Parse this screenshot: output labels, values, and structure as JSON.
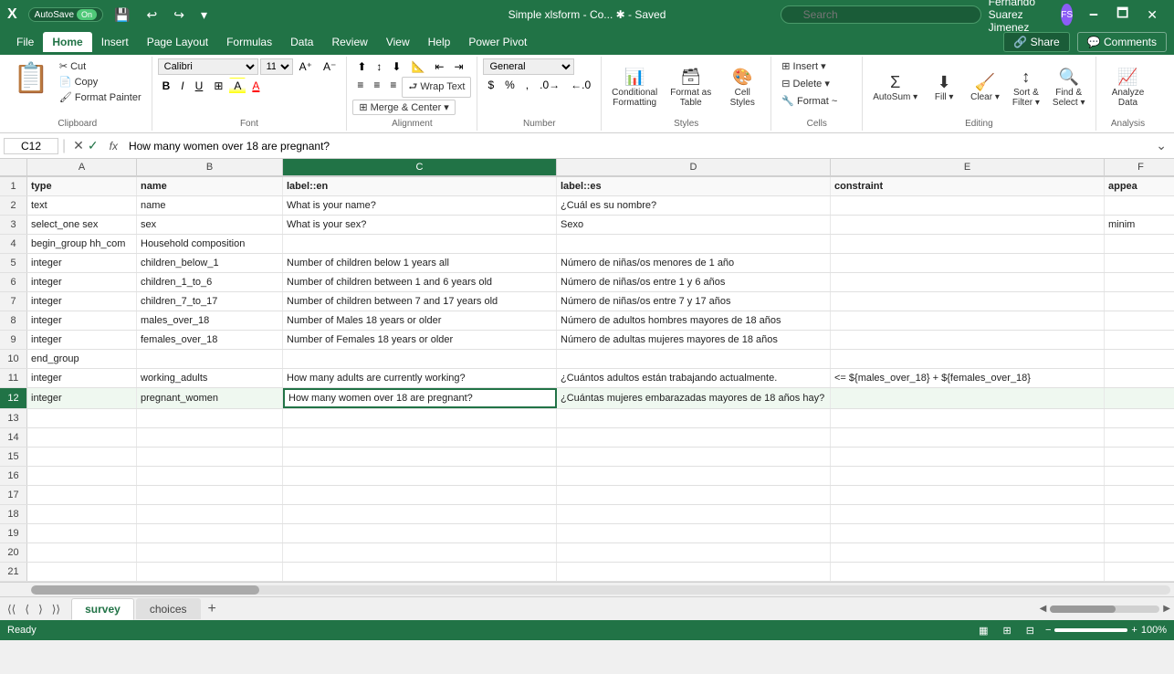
{
  "titlebar": {
    "autosave_label": "AutoSave",
    "autosave_state": "On",
    "title": "Simple xlsform - Co... ✱ - Saved",
    "search_placeholder": "Search",
    "user_name": "Fernando Suarez Jimenez",
    "undo": "↩",
    "redo": "↪",
    "minimize": "🗕",
    "maximize": "🗖",
    "close": "✕"
  },
  "tabs": {
    "items": [
      "File",
      "Home",
      "Insert",
      "Page Layout",
      "Formulas",
      "Data",
      "Review",
      "View",
      "Help",
      "Power Pivot"
    ],
    "active": "Home"
  },
  "ribbon": {
    "clipboard": {
      "label": "Clipboard",
      "paste_label": "Paste",
      "cut_label": "Cut",
      "copy_label": "Copy",
      "format_painter_label": "Format Painter"
    },
    "font": {
      "label": "Font",
      "font_name": "Calibri",
      "font_size": "11",
      "bold": "B",
      "italic": "I",
      "underline": "U"
    },
    "alignment": {
      "label": "Alignment",
      "wrap_text": "Wrap Text",
      "merge_center": "Merge & Center"
    },
    "number": {
      "label": "Number",
      "format": "General"
    },
    "styles": {
      "label": "Styles",
      "conditional_formatting": "Conditional Formatting",
      "format_as_table": "Format as Table",
      "cell_styles": "Cell Styles"
    },
    "cells": {
      "label": "Cells",
      "insert": "Insert",
      "delete": "Delete",
      "format": "Format ~"
    },
    "editing": {
      "label": "Editing",
      "sort_filter": "Sort & Filter",
      "find_select": "Find & Select ~",
      "analyze": "Analyze Data"
    }
  },
  "formula_bar": {
    "cell_ref": "C12",
    "formula": "How many women over 18 are pregnant?"
  },
  "columns": {
    "headers": [
      "A",
      "B",
      "C",
      "D",
      "E",
      "F"
    ],
    "labels": [
      "",
      "",
      "",
      "",
      "",
      ""
    ]
  },
  "spreadsheet": {
    "rows": [
      {
        "num": "1",
        "cells": [
          "type",
          "name",
          "label::en",
          "label::es",
          "constraint",
          "appea"
        ]
      },
      {
        "num": "2",
        "cells": [
          "text",
          "name",
          "What is your name?",
          "¿Cuál es su nombre?",
          "",
          ""
        ]
      },
      {
        "num": "3",
        "cells": [
          "select_one sex",
          "sex",
          "What is your sex?",
          "Sexo",
          "",
          "minim"
        ]
      },
      {
        "num": "4",
        "cells": [
          "begin_group hh_com",
          "Household composition",
          "",
          "",
          "",
          ""
        ]
      },
      {
        "num": "5",
        "cells": [
          "integer",
          "children_below_1",
          "Number of children below 1 years all",
          "Número de niñas/os menores de 1 año",
          "",
          ""
        ]
      },
      {
        "num": "6",
        "cells": [
          "integer",
          "children_1_to_6",
          "Number of children between 1 and 6 years old",
          "Número de niñas/os entre 1 y 6 años",
          "",
          ""
        ]
      },
      {
        "num": "7",
        "cells": [
          "integer",
          "children_7_to_17",
          "Number of children between 7 and 17 years old",
          "Número de niñas/os entre 7 y 17 años",
          "",
          ""
        ]
      },
      {
        "num": "8",
        "cells": [
          "integer",
          "males_over_18",
          "Number of Males 18 years or older",
          "Número de adultos hombres mayores de 18 años",
          "",
          ""
        ]
      },
      {
        "num": "9",
        "cells": [
          "integer",
          "females_over_18",
          "Number of Females 18 years or older",
          "Número de adultas mujeres mayores de 18 años",
          "",
          ""
        ]
      },
      {
        "num": "10",
        "cells": [
          "end_group",
          "",
          "",
          "",
          "",
          ""
        ]
      },
      {
        "num": "11",
        "cells": [
          "integer",
          "working_adults",
          "How many adults are currently working?",
          "¿Cuántos adultos están trabajando actualmente.",
          "<= ${males_over_18} + ${females_over_18}",
          ""
        ]
      },
      {
        "num": "12",
        "cells": [
          "integer",
          "pregnant_women",
          "How many women over 18 are pregnant?",
          "¿Cuántas mujeres embarazadas mayores de 18 años hay?",
          "",
          ""
        ],
        "active": true
      },
      {
        "num": "13",
        "cells": [
          "",
          "",
          "",
          "",
          "",
          ""
        ]
      },
      {
        "num": "14",
        "cells": [
          "",
          "",
          "",
          "",
          "",
          ""
        ]
      },
      {
        "num": "15",
        "cells": [
          "",
          "",
          "",
          "",
          "",
          ""
        ]
      },
      {
        "num": "16",
        "cells": [
          "",
          "",
          "",
          "",
          "",
          ""
        ]
      },
      {
        "num": "17",
        "cells": [
          "",
          "",
          "",
          "",
          "",
          ""
        ]
      },
      {
        "num": "18",
        "cells": [
          "",
          "",
          "",
          "",
          "",
          ""
        ]
      },
      {
        "num": "19",
        "cells": [
          "",
          "",
          "",
          "",
          "",
          ""
        ]
      },
      {
        "num": "20",
        "cells": [
          "",
          "",
          "",
          "",
          "",
          ""
        ]
      },
      {
        "num": "21",
        "cells": [
          "",
          "",
          "",
          "",
          "",
          ""
        ]
      }
    ]
  },
  "sheets": {
    "tabs": [
      "survey",
      "choices"
    ],
    "active": "survey",
    "add_label": "+"
  },
  "statusbar": {
    "ready": "Ready",
    "zoom": "100%"
  }
}
